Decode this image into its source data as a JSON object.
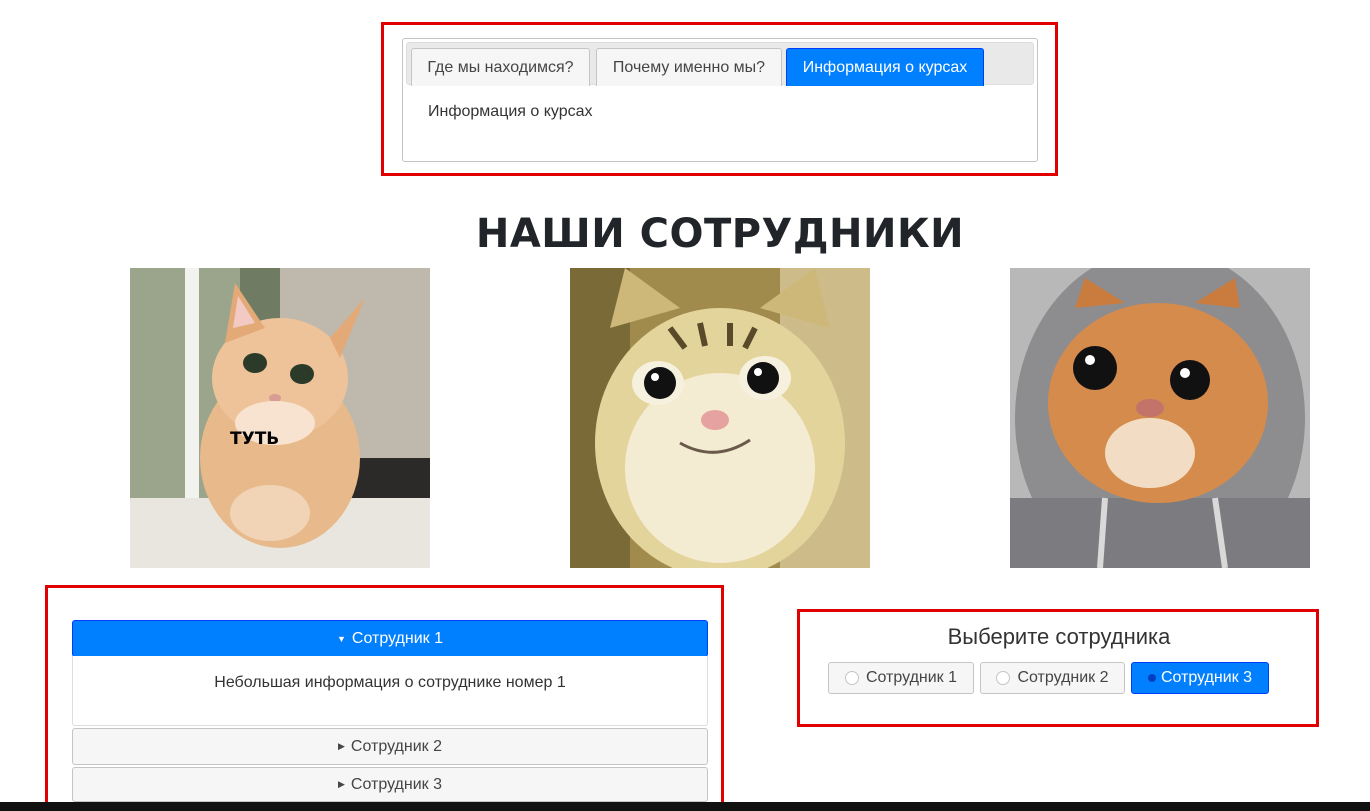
{
  "tabs": {
    "items": [
      {
        "label": "Где мы находимся?"
      },
      {
        "label": "Почему именно мы?"
      },
      {
        "label": "Информация о курсах"
      }
    ],
    "active_index": 2,
    "panel_text": "Информация о курсах"
  },
  "staff": {
    "title": "НАШИ СОТРУДНИКИ",
    "photo1_caption": "ТУТЬ"
  },
  "accordion": {
    "items": [
      {
        "label": "Сотрудник 1",
        "expanded": true
      },
      {
        "label": "Сотрудник 2",
        "expanded": false
      },
      {
        "label": "Сотрудник 3",
        "expanded": false
      }
    ],
    "content_text": "Небольшая информация о сотруднике номер 1"
  },
  "radio_group": {
    "title": "Выберите сотрудника",
    "options": [
      {
        "label": "Сотрудник 1"
      },
      {
        "label": "Сотрудник 2"
      },
      {
        "label": "Сотрудник 3"
      }
    ],
    "selected_index": 2
  },
  "colors": {
    "accent": "#007fff",
    "highlight_border": "#e00000"
  },
  "icons": {
    "accordion_expanded": "caret-down-icon",
    "accordion_collapsed": "caret-right-icon",
    "radio": "radio-circle-icon"
  }
}
